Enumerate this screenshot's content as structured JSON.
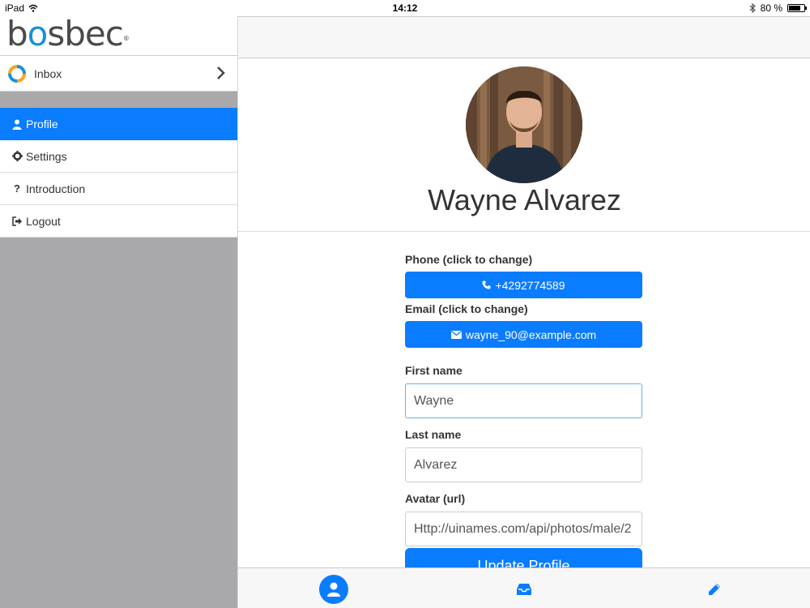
{
  "statusbar": {
    "device": "iPad",
    "time": "14:12",
    "battery": "80 %",
    "battery_level": 0.8
  },
  "brand": {
    "logo_b": "b",
    "logo_o": "o",
    "logo_rest": "sbec",
    "reg": "®"
  },
  "sidebar": {
    "inbox_label": "Inbox",
    "items": [
      {
        "label": "Profile",
        "icon": "user-icon",
        "active": true
      },
      {
        "label": "Settings",
        "icon": "gear-icon",
        "active": false
      },
      {
        "label": "Introduction",
        "icon": "question-icon",
        "active": false
      },
      {
        "label": "Logout",
        "icon": "sign-out-icon",
        "active": false
      }
    ]
  },
  "profile": {
    "name": "Wayne Alvarez",
    "phone_label": "Phone (click to change)",
    "phone": "+4292774589",
    "email_label": "Email (click to change)",
    "email": "wayne_90@example.com",
    "first_name_label": "First name",
    "first_name": "Wayne",
    "last_name_label": "Last name",
    "last_name": "Alvarez",
    "avatar_label": "Avatar (url)",
    "avatar_url": "Http://uinames.com/api/photos/male/2",
    "update_button": "Update Profile"
  },
  "colors": {
    "accent": "#0a7cff",
    "sidebar_bg": "#a9a9ab"
  },
  "tabbar": [
    "profile-tab-icon",
    "inbox-tab-icon",
    "compose-tab-icon"
  ]
}
